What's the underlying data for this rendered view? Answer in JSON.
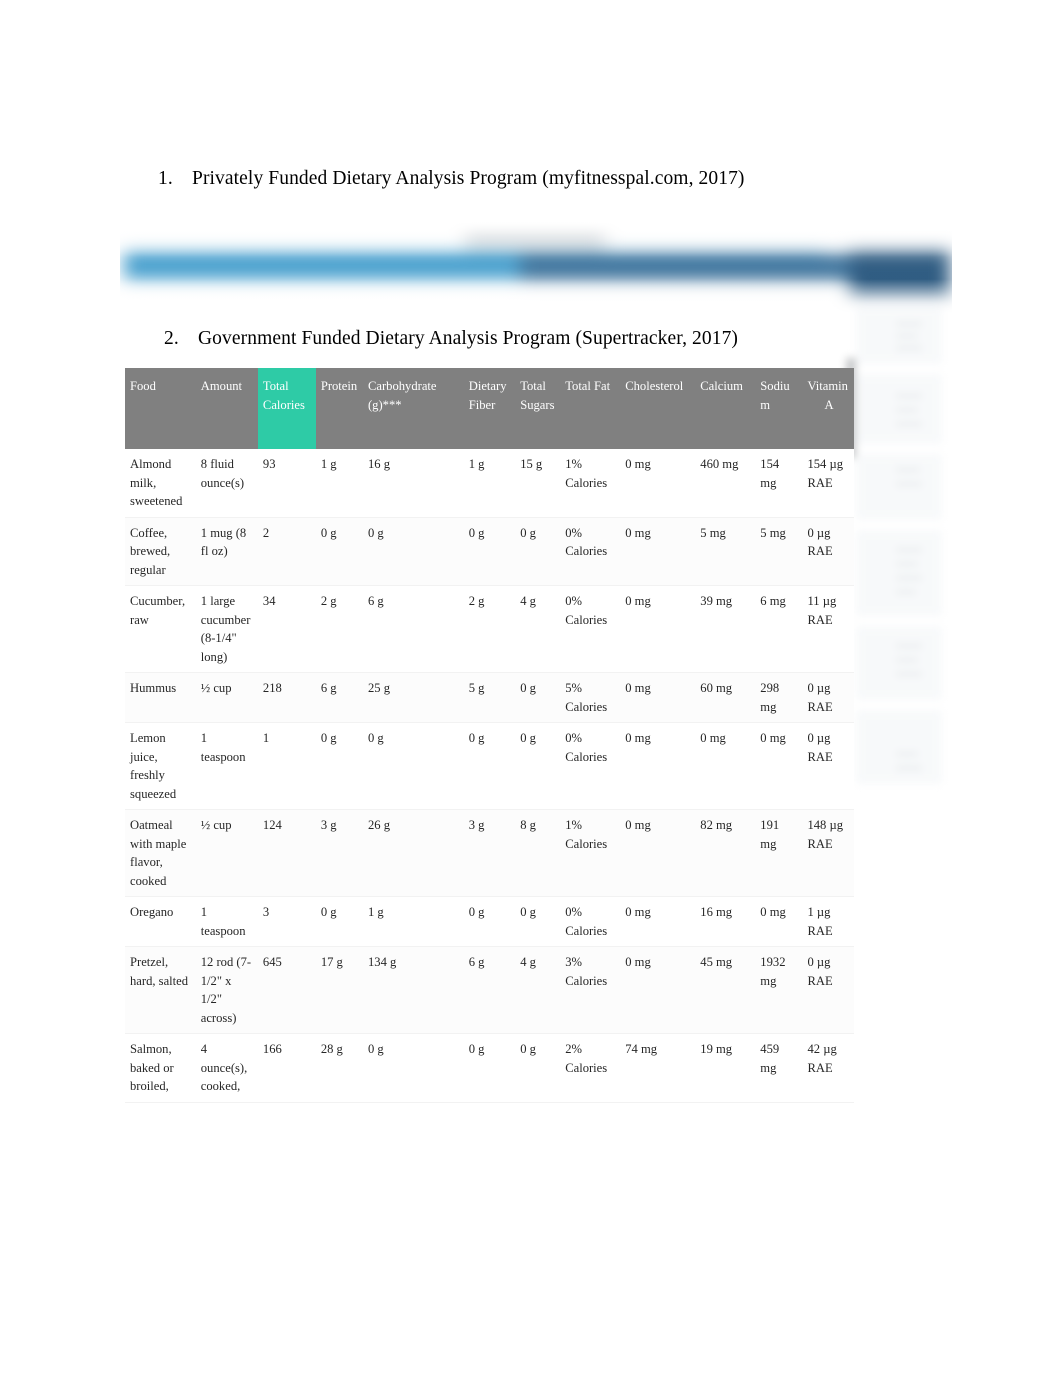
{
  "document": {
    "headings": [
      {
        "number": "1.",
        "text": "Privately Funded Dietary Analysis Program (myfitnesspal.com, 2017)"
      },
      {
        "number": "2.",
        "text": "Government Funded Dietary Analysis Program (Supertracker, 2017)"
      }
    ]
  },
  "colors": {
    "header_background": "#808080",
    "header_highlight": "#2ecba6",
    "screenshot_bar_light": "#3596c9",
    "screenshot_bar_dark": "#2b6693",
    "screenshot_box_dark": "#25547c",
    "page_background": "#ffffff",
    "body_text": "#262626"
  },
  "table": {
    "columns": [
      {
        "key": "food",
        "label": "Food",
        "highlight": false
      },
      {
        "key": "amount",
        "label": "Amount",
        "highlight": false
      },
      {
        "key": "calories",
        "label": "Total Calories",
        "highlight": true
      },
      {
        "key": "protein",
        "label": "Protein",
        "highlight": false
      },
      {
        "key": "carbohydrate",
        "label": "Carbohydrate (g)***",
        "highlight": false
      },
      {
        "key": "fiber",
        "label": "Dietary Fiber",
        "highlight": false
      },
      {
        "key": "sugars",
        "label": "Total Sugars",
        "highlight": false
      },
      {
        "key": "fat",
        "label": "Total Fat",
        "highlight": false
      },
      {
        "key": "cholesterol",
        "label": "Cholesterol",
        "highlight": false
      },
      {
        "key": "calcium",
        "label": "Calcium",
        "highlight": false
      },
      {
        "key": "sodium",
        "label": "Sodium",
        "highlight": false
      },
      {
        "key": "vitamin_a_line1",
        "label": "Vitamin",
        "highlight": false
      },
      {
        "key": "vitamin_a_line2",
        "label": "A",
        "highlight": false
      }
    ],
    "rows": [
      {
        "food": "Almond milk, sweetened",
        "amount": "8 fluid ounce(s)",
        "calories": "93",
        "protein": "1 g",
        "carbohydrate": "16 g",
        "fiber": "1 g",
        "sugars": "15 g",
        "fat": "1% Calories",
        "cholesterol": "0 mg",
        "calcium": "460 mg",
        "sodium": "154 mg",
        "vitamin_a": "154 µg RAE"
      },
      {
        "food": "Coffee, brewed, regular",
        "amount": "1 mug (8 fl oz)",
        "calories": "2",
        "protein": "0 g",
        "carbohydrate": "0 g",
        "fiber": "0 g",
        "sugars": "0 g",
        "fat": "0% Calories",
        "cholesterol": "0 mg",
        "calcium": "5 mg",
        "sodium": "5 mg",
        "vitamin_a": "0 µg RAE"
      },
      {
        "food": "Cucumber, raw",
        "amount": "1 large cucumber (8-1/4\" long)",
        "calories": "34",
        "protein": "2 g",
        "carbohydrate": "6 g",
        "fiber": "2 g",
        "sugars": "4 g",
        "fat": "0% Calories",
        "cholesterol": "0 mg",
        "calcium": "39 mg",
        "sodium": "6 mg",
        "vitamin_a": "11 µg RAE"
      },
      {
        "food": "Hummus",
        "amount": "½ cup",
        "calories": "218",
        "protein": "6 g",
        "carbohydrate": "25 g",
        "fiber": "5 g",
        "sugars": "0 g",
        "fat": "5% Calories",
        "cholesterol": "0 mg",
        "calcium": "60 mg",
        "sodium": "298 mg",
        "vitamin_a": "0 µg RAE"
      },
      {
        "food": "Lemon juice, freshly squeezed",
        "amount": "1 teaspoon",
        "calories": "1",
        "protein": "0 g",
        "carbohydrate": "0 g",
        "fiber": "0 g",
        "sugars": "0 g",
        "fat": "0% Calories",
        "cholesterol": "0 mg",
        "calcium": "0 mg",
        "sodium": "0 mg",
        "vitamin_a": "0 µg RAE"
      },
      {
        "food": "Oatmeal with maple flavor, cooked",
        "amount": "½ cup",
        "calories": "124",
        "protein": "3 g",
        "carbohydrate": "26 g",
        "fiber": "3 g",
        "sugars": "8 g",
        "fat": "1% Calories",
        "cholesterol": "0 mg",
        "calcium": "82 mg",
        "sodium": "191 mg",
        "vitamin_a": "148 µg RAE"
      },
      {
        "food": "Oregano",
        "amount": "1 teaspoon",
        "calories": "3",
        "protein": "0 g",
        "carbohydrate": "1 g",
        "fiber": "0 g",
        "sugars": "0 g",
        "fat": "0% Calories",
        "cholesterol": "0 mg",
        "calcium": "16 mg",
        "sodium": "0 mg",
        "vitamin_a": "1 µg RAE"
      },
      {
        "food": "Pretzel, hard, salted",
        "amount": "12 rod (7-1/2\" x 1/2\" across)",
        "calories": "645",
        "protein": "17 g",
        "carbohydrate": "134 g",
        "fiber": "6 g",
        "sugars": "4 g",
        "fat": "3% Calories",
        "cholesterol": "0 mg",
        "calcium": "45 mg",
        "sodium": "1932 mg",
        "vitamin_a": "0 µg RAE"
      },
      {
        "food": "Salmon, baked or broiled,",
        "amount": "4 ounce(s), cooked,",
        "calories": "166",
        "protein": "28 g",
        "carbohydrate": "0 g",
        "fiber": "0 g",
        "sugars": "0 g",
        "fat": "2% Calories",
        "cholesterol": "74 mg",
        "calcium": "19 mg",
        "sodium": "459 mg",
        "vitamin_a": "42 µg RAE"
      }
    ]
  }
}
